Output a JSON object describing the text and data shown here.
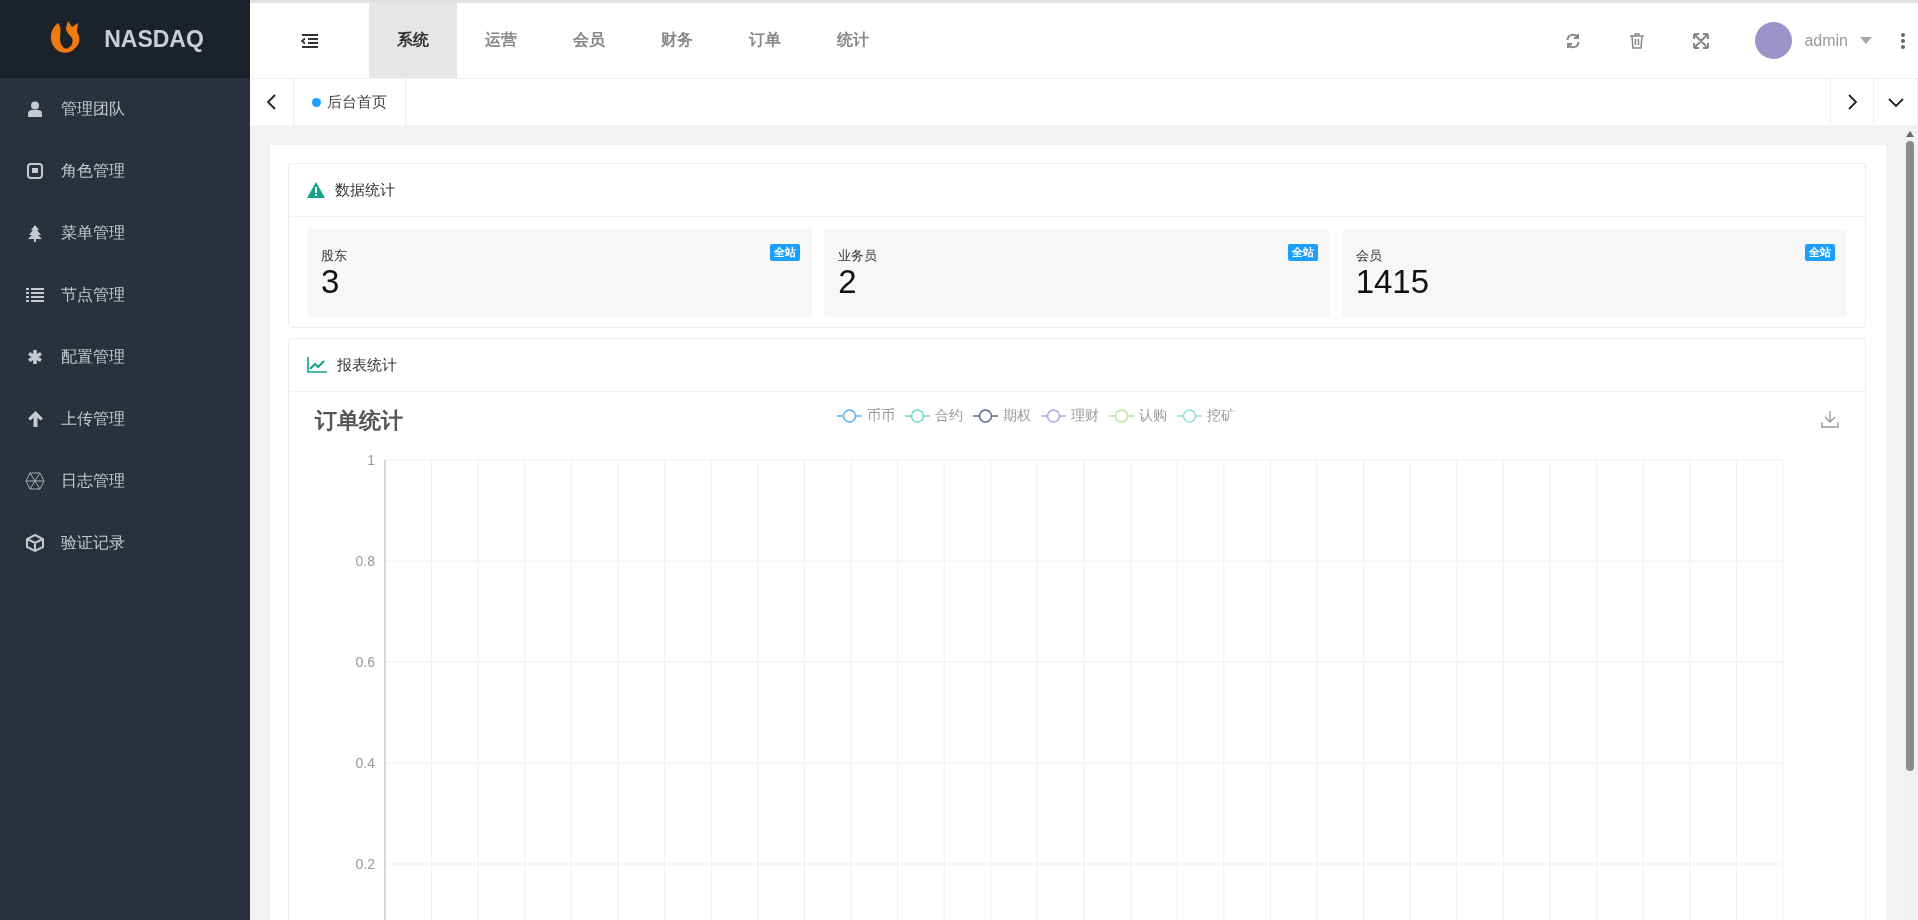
{
  "brand": {
    "name": "NASDAQ"
  },
  "top_nav": [
    {
      "label": "系统",
      "selected": true
    },
    {
      "label": "运营",
      "selected": false
    },
    {
      "label": "会员",
      "selected": false
    },
    {
      "label": "财务",
      "selected": false
    },
    {
      "label": "订单",
      "selected": false
    },
    {
      "label": "统计",
      "selected": false
    }
  ],
  "user": {
    "name": "admin"
  },
  "sidebar": {
    "items": [
      {
        "label": "管理团队"
      },
      {
        "label": "角色管理"
      },
      {
        "label": "菜单管理"
      },
      {
        "label": "节点管理"
      },
      {
        "label": "配置管理"
      },
      {
        "label": "上传管理"
      },
      {
        "label": "日志管理"
      },
      {
        "label": "验证记录"
      }
    ]
  },
  "page_tabs": [
    {
      "label": "后台首页",
      "selected": true
    }
  ],
  "stats_panel": {
    "title": "数据统计",
    "cards": [
      {
        "label": "股东",
        "value": "3",
        "badge": "全站"
      },
      {
        "label": "业务员",
        "value": "2",
        "badge": "全站"
      },
      {
        "label": "会员",
        "value": "1415",
        "badge": "全站"
      }
    ]
  },
  "report_panel": {
    "title": "报表统计",
    "chart_data": {
      "type": "line",
      "title": "订单统计",
      "series": [
        {
          "name": "币币",
          "color": "#5ab1ef"
        },
        {
          "name": "合约",
          "color": "#6fdcb8"
        },
        {
          "name": "期权",
          "color": "#59678c"
        },
        {
          "name": "理财",
          "color": "#a9a6ec"
        },
        {
          "name": "认购",
          "color": "#b6e6a0"
        },
        {
          "name": "挖矿",
          "color": "#8fdfe0"
        }
      ],
      "ylim": [
        0,
        1
      ],
      "grid": true,
      "yticks": [
        0.2,
        0.4,
        0.6,
        0.8,
        1
      ]
    }
  }
}
